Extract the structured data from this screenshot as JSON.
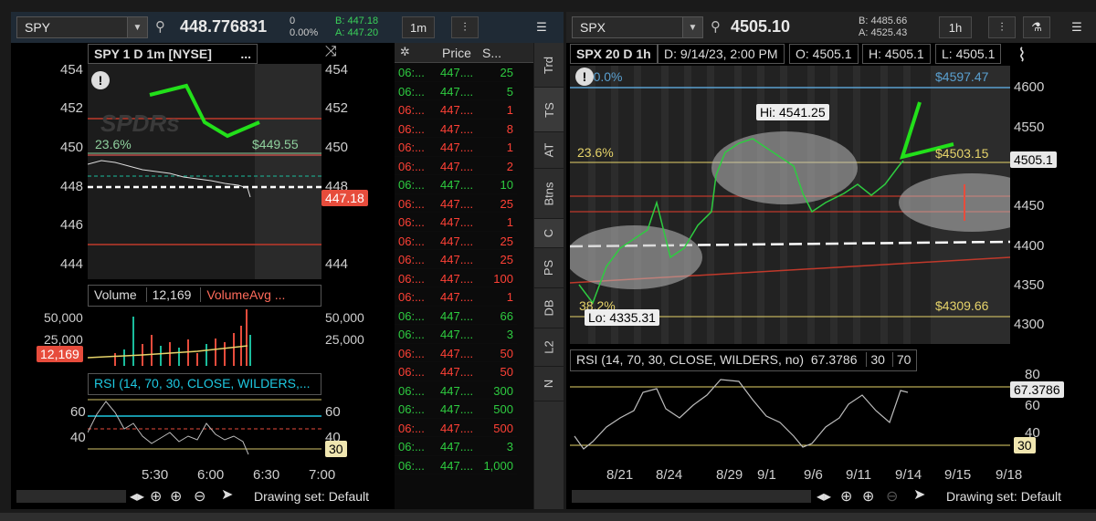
{
  "left": {
    "symbol": "SPY",
    "last": "448.776831",
    "chg": "0",
    "chg_pct": "0.00%",
    "bid": "B: 447.18",
    "ask": "A: 447.20",
    "timeframe": "1m",
    "chart_title": "SPY 1 D 1m [NYSE]",
    "chart_menu": "...",
    "watermark": "SPDRs",
    "price_axis": [
      "454",
      "452",
      "450",
      "448",
      "446",
      "444"
    ],
    "price_axis_right": [
      "454",
      "452",
      "450",
      "448",
      "446",
      "444"
    ],
    "fib_236": "23.6%",
    "fib_price": "$449.55",
    "last_tag": "447.18",
    "volume_label": "Volume",
    "volume_value": "12,169",
    "volume_avg": "VolumeAvg ...",
    "volume_axis": [
      "50,000",
      "25,000"
    ],
    "volume_axis_right": [
      "50,000",
      "25,000"
    ],
    "volume_tag": "12,169",
    "rsi_label": "RSI (14, 70, 30, CLOSE, WILDERS,...",
    "rsi_axis": [
      "60",
      "40"
    ],
    "rsi_axis_right": [
      "60",
      "40"
    ],
    "rsi_tag": "30",
    "time_axis": [
      "5:30",
      "6:00",
      "6:30",
      "7:00"
    ],
    "drawing_set": "Drawing set: Default"
  },
  "time_sales": {
    "col_price": "Price",
    "col_size": "S...",
    "rows": [
      {
        "time": "06:...",
        "price": "447....",
        "size": "25",
        "color": "#2ecc40"
      },
      {
        "time": "06:...",
        "price": "447....",
        "size": "5",
        "color": "#2ecc40"
      },
      {
        "time": "06:...",
        "price": "447....",
        "size": "1",
        "color": "#ff4136"
      },
      {
        "time": "06:...",
        "price": "447....",
        "size": "8",
        "color": "#ff4136"
      },
      {
        "time": "06:...",
        "price": "447....",
        "size": "1",
        "color": "#ff4136"
      },
      {
        "time": "06:...",
        "price": "447....",
        "size": "2",
        "color": "#ff4136"
      },
      {
        "time": "06:...",
        "price": "447....",
        "size": "10",
        "color": "#2ecc40"
      },
      {
        "time": "06:...",
        "price": "447....",
        "size": "25",
        "color": "#ff4136"
      },
      {
        "time": "06:...",
        "price": "447....",
        "size": "1",
        "color": "#ff4136"
      },
      {
        "time": "06:...",
        "price": "447....",
        "size": "25",
        "color": "#ff4136"
      },
      {
        "time": "06:...",
        "price": "447....",
        "size": "25",
        "color": "#ff4136"
      },
      {
        "time": "06:...",
        "price": "447....",
        "size": "100",
        "color": "#ff4136"
      },
      {
        "time": "06:...",
        "price": "447....",
        "size": "1",
        "color": "#ff4136"
      },
      {
        "time": "06:...",
        "price": "447....",
        "size": "66",
        "color": "#2ecc40"
      },
      {
        "time": "06:...",
        "price": "447....",
        "size": "3",
        "color": "#2ecc40"
      },
      {
        "time": "06:...",
        "price": "447....",
        "size": "50",
        "color": "#ff4136"
      },
      {
        "time": "06:...",
        "price": "447....",
        "size": "50",
        "color": "#ff4136"
      },
      {
        "time": "06:...",
        "price": "447....",
        "size": "300",
        "color": "#2ecc40"
      },
      {
        "time": "06:...",
        "price": "447....",
        "size": "500",
        "color": "#2ecc40"
      },
      {
        "time": "06:...",
        "price": "447....",
        "size": "500",
        "color": "#ff4136"
      },
      {
        "time": "06:...",
        "price": "447....",
        "size": "3",
        "color": "#2ecc40"
      },
      {
        "time": "06:...",
        "price": "447....",
        "size": "1,000",
        "color": "#2ecc40"
      }
    ],
    "tabs": [
      "Trd",
      "TS",
      "AT",
      "Btns",
      "C",
      "PS",
      "DB",
      "L2",
      "N"
    ]
  },
  "right": {
    "symbol": "SPX",
    "last": "4505.10",
    "bid": "B: 4485.66",
    "ask": "A: 4525.43",
    "timeframe": "1h",
    "chart_title": "SPX 20 D 1h",
    "date": "D: 9/14/23, 2:00 PM",
    "open": "O: 4505.1",
    "high": "H: 4505.1",
    "low": "L: 4505.1",
    "fib_100": "100.0%",
    "fib_top_price": "$4597.47",
    "fib_236": "23.6%",
    "fib_236_price": "$4503.15",
    "fib_bottom_price": "$4309.66",
    "fib_bottom_pct": "38.2%",
    "hi_label": "Hi: 4541.25",
    "lo_label": "Lo: 4335.31",
    "price_tag": "4505.1",
    "price_axis": [
      "4600",
      "4550",
      "4500",
      "4450",
      "4400",
      "4350",
      "4300"
    ],
    "rsi_label": "RSI (14, 70, 30, CLOSE, WILDERS, no)",
    "rsi_value": "67.3786",
    "rsi_30": "30",
    "rsi_70": "70",
    "rsi_tag": "67.3786",
    "rsi_tag30": "30",
    "rsi_axis": [
      "80",
      "60",
      "40"
    ],
    "date_axis": [
      "8/21",
      "8/24",
      "8/29",
      "9/1",
      "9/6",
      "9/11",
      "9/14",
      "9/15",
      "9/18"
    ],
    "drawing_set": "Drawing set: Default"
  }
}
